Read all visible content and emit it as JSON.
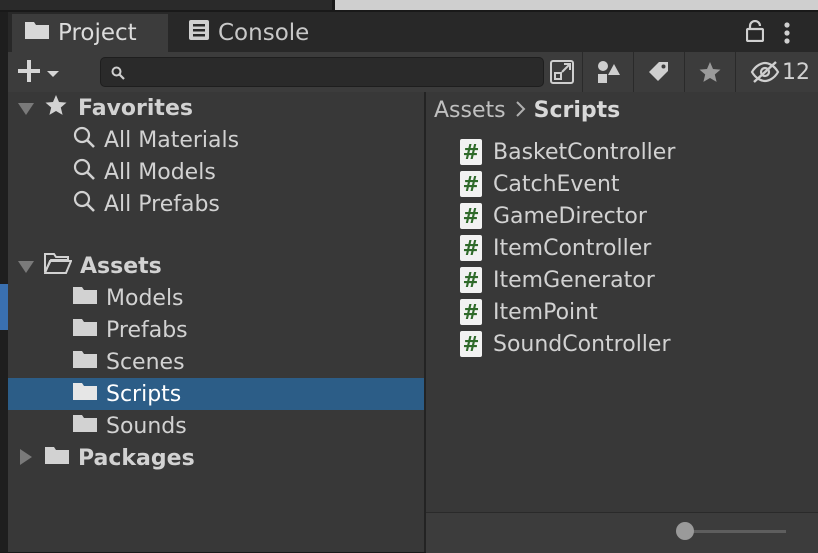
{
  "tabs": [
    {
      "label": "Project",
      "icon": "folder-icon",
      "active": true
    },
    {
      "label": "Console",
      "icon": "console-icon",
      "active": false
    }
  ],
  "toolbar": {
    "search_placeholder": "",
    "hidden_count": "12"
  },
  "tree": {
    "favorites": {
      "label": "Favorites",
      "items": [
        "All Materials",
        "All Models",
        "All Prefabs"
      ]
    },
    "assets": {
      "label": "Assets",
      "items": [
        "Models",
        "Prefabs",
        "Scenes",
        "Scripts",
        "Sounds"
      ],
      "selected": "Scripts"
    },
    "packages": {
      "label": "Packages"
    }
  },
  "breadcrumb": {
    "root": "Assets",
    "current": "Scripts"
  },
  "files": [
    "BasketController",
    "CatchEvent",
    "GameDirector",
    "ItemController",
    "ItemGenerator",
    "ItemPoint",
    "SoundController"
  ],
  "colors": {
    "selection": "#2c5d87",
    "panel": "#383838",
    "script_icon": "#2f6a2a"
  },
  "zoom_slider": {
    "value": 0
  }
}
